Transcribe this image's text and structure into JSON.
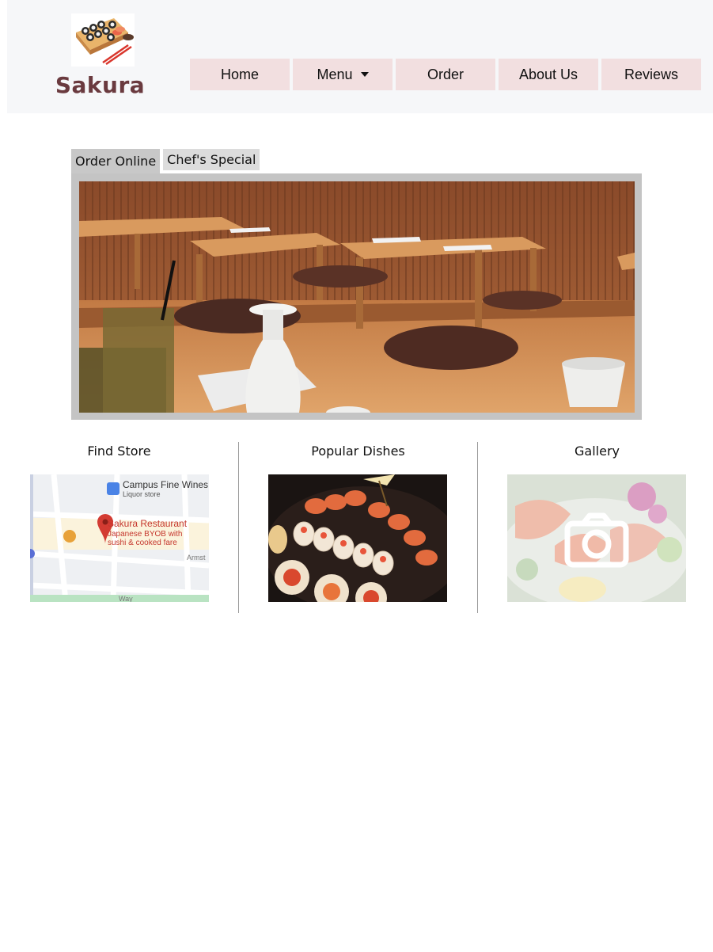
{
  "brand": {
    "name": "Sakura"
  },
  "nav": {
    "items": [
      {
        "label": "Home"
      },
      {
        "label": "Menu"
      },
      {
        "label": "Order"
      },
      {
        "label": "About Us"
      },
      {
        "label": "Reviews"
      }
    ]
  },
  "tabs": [
    {
      "label": "Order Online",
      "active": true
    },
    {
      "label": "Chef's Special",
      "active": false
    }
  ],
  "sections": [
    {
      "title": "Find Store"
    },
    {
      "title": "Popular Dishes"
    },
    {
      "title": "Gallery"
    }
  ],
  "map": {
    "place1_name": "Campus Fine Wines",
    "place1_type": "Liquor store",
    "place2_name": "Sakura Restaurant",
    "place2_desc1": "Japanese BYOB with",
    "place2_desc2": "sushi & cooked fare",
    "street1": "Armst",
    "street2": "Way"
  },
  "colors": {
    "header_bg": "#f6f7f9",
    "nav_bg": "#f2dfe0",
    "brand": "#6a3a3f",
    "tab_active": "#c8c8c8",
    "frame": "#c4c4c4"
  },
  "icons": {
    "gallery": "camera-icon",
    "menu_dropdown": "caret-down-icon",
    "map_pin": "map-pin-icon"
  }
}
